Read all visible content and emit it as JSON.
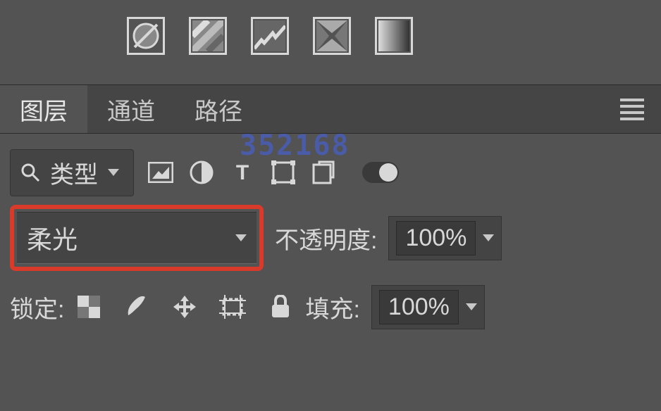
{
  "watermark": "352168",
  "tabs": {
    "layers": "图层",
    "channels": "通道",
    "paths": "路径"
  },
  "filter": {
    "label": "类型"
  },
  "blend": {
    "mode": "柔光",
    "opacity_label": "不透明度:",
    "opacity_value": "100%"
  },
  "lock": {
    "label": "锁定:",
    "fill_label": "填充:",
    "fill_value": "100%"
  }
}
